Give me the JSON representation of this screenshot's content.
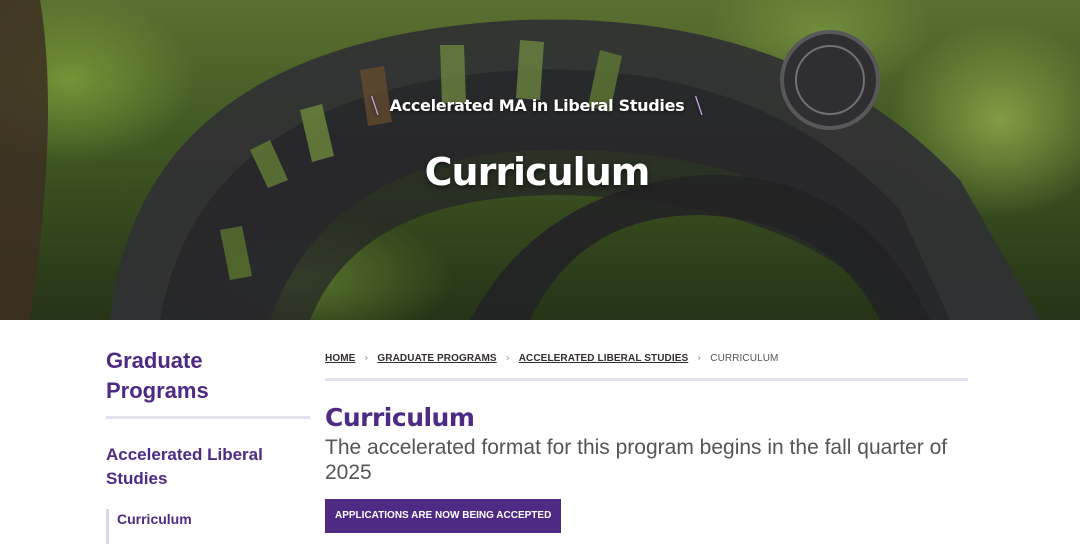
{
  "hero": {
    "eyebrow": "Accelerated MA in Liberal Studies",
    "title": "Curriculum"
  },
  "sidebar": {
    "heading": "Graduate Programs",
    "section_link": "Accelerated Liberal Studies",
    "sub_link": "Curriculum"
  },
  "breadcrumb": {
    "items": [
      "HOME",
      "GRADUATE PROGRAMS",
      "ACCELERATED LIBERAL STUDIES",
      "CURRICULUM"
    ]
  },
  "main": {
    "title": "Curriculum",
    "lead": "The accelerated format for this program begins in the fall quarter of 2025",
    "cta_label": "APPLICATIONS ARE NOW BEING ACCEPTED"
  },
  "colors": {
    "brand_purple": "#4e2a84",
    "accent_lavender": "#c8a2e8"
  }
}
